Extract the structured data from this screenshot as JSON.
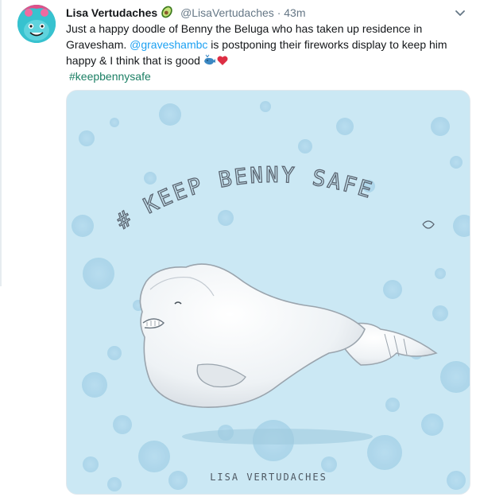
{
  "tweet": {
    "display_name": "Lisa Vertudaches",
    "handle": "@LisaVertudaches",
    "separator": "·",
    "time": "43m",
    "text_part1": "Just a happy doodle of Benny the Beluga who has taken up residence in Gravesham. ",
    "mention": "@gravesham",
    "mention_tail": "bc",
    "text_part2": " is postponing their fireworks display to keep him happy & I think that is good ",
    "hashtag": "#keepbennysafe"
  },
  "image": {
    "title": "# KEEP BENNY SAFE",
    "signature": "LISA VERTUDACHES"
  },
  "icons": {
    "avatar": "cartoon-avatar",
    "badge": "avocado-emoji",
    "menu": "chevron-down-icon",
    "whale": "whale-emoji",
    "heart": "heart-emoji"
  },
  "colors": {
    "name": "#14171a",
    "secondary": "#657786",
    "link": "#1da1f2",
    "hashtag": "#1b7f64",
    "image_bg": "#cbe8f4"
  }
}
